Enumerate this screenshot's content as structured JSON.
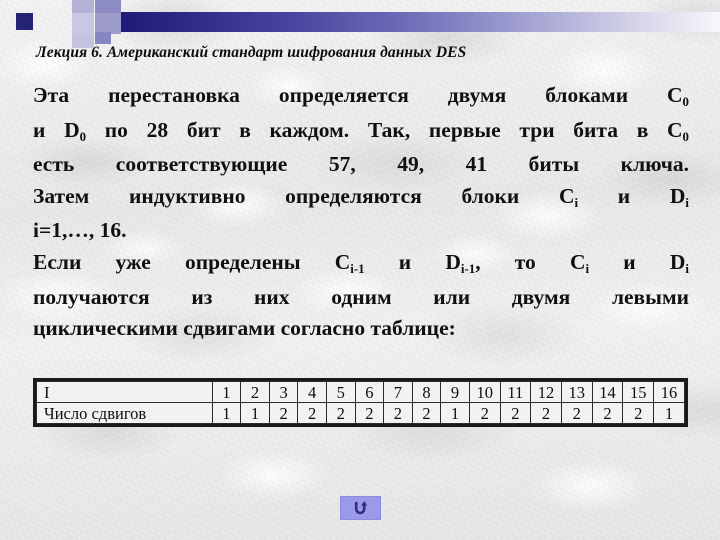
{
  "slide": {
    "title": "Лекция 6. Американский стандарт шифрования данных DES",
    "background_color": "#efeeee",
    "accent_color": "#252374",
    "header_gradient_from": "#1e1c78",
    "header_gradient_to": "#f7f7fb"
  },
  "body": {
    "lines": [
      {
        "id": "line1",
        "justify": true,
        "html": "Эта перестановка определяется двумя блоками C<sub>0</sub>"
      },
      {
        "id": "line2",
        "justify": true,
        "html": "и D<sub>0</sub> по 28 бит в каждом. Так, первые три бита в C<sub>0</sub>"
      },
      {
        "id": "line3",
        "justify": true,
        "html": "есть соответствующие 57, 49, 41 биты ключа."
      },
      {
        "id": "line4",
        "justify": true,
        "html": "Затем индуктивно определяются блоки C<sub>i</sub> и D<sub>i</sub>"
      },
      {
        "id": "line5",
        "justify": false,
        "html": "i=1,…, 16."
      },
      {
        "id": "line6",
        "justify": true,
        "html": "Если уже определены C<sub>i-1</sub> и D<sub>i-1</sub>, то C<sub>i</sub> и D<sub>i</sub>"
      },
      {
        "id": "line7",
        "justify": true,
        "html": "получаются из них одним или двумя левыми"
      },
      {
        "id": "line8",
        "justify": false,
        "html": "циклическими сдвигами согласно таблице:"
      }
    ],
    "plain_text": "Эта перестановка определяется двумя блоками C0 и D0 по 28 бит в каждом. Так, первые три бита в C0 есть соответствующие 57, 49, 41 биты ключа. Затем индуктивно определяются блоки Ci и Di i=1,…, 16. Если уже определены Ci-1 и Di-1, то Ci и Di получаются из них одним или двумя левыми циклическими сдвигами согласно таблице:"
  },
  "table": {
    "rows": [
      {
        "label": "I",
        "values": [
          "1",
          "2",
          "3",
          "4",
          "5",
          "6",
          "7",
          "8",
          "9",
          "10",
          "11",
          "12",
          "13",
          "14",
          "15",
          "16"
        ]
      },
      {
        "label": "Число сдвигов",
        "values": [
          "1",
          "1",
          "2",
          "2",
          "2",
          "2",
          "2",
          "2",
          "1",
          "2",
          "2",
          "2",
          "2",
          "2",
          "2",
          "1"
        ]
      }
    ]
  },
  "footer": {
    "return_button": {
      "icon": "return-arrow-icon",
      "label": "",
      "background_color": "#9c9ae8",
      "icon_color": "#2f2d86"
    }
  }
}
